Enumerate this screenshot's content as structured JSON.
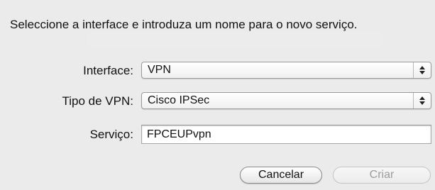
{
  "dialog": {
    "prompt": "Seleccione a interface e introduza um nome para o novo serviço.",
    "interface": {
      "label": "Interface:",
      "value": "VPN"
    },
    "vpn_type": {
      "label": "Tipo de VPN:",
      "value": "Cisco IPSec"
    },
    "service": {
      "label": "Serviço:",
      "value": "FPCEUPvpn"
    },
    "buttons": {
      "cancel": "Cancelar",
      "create": "Criar"
    }
  }
}
